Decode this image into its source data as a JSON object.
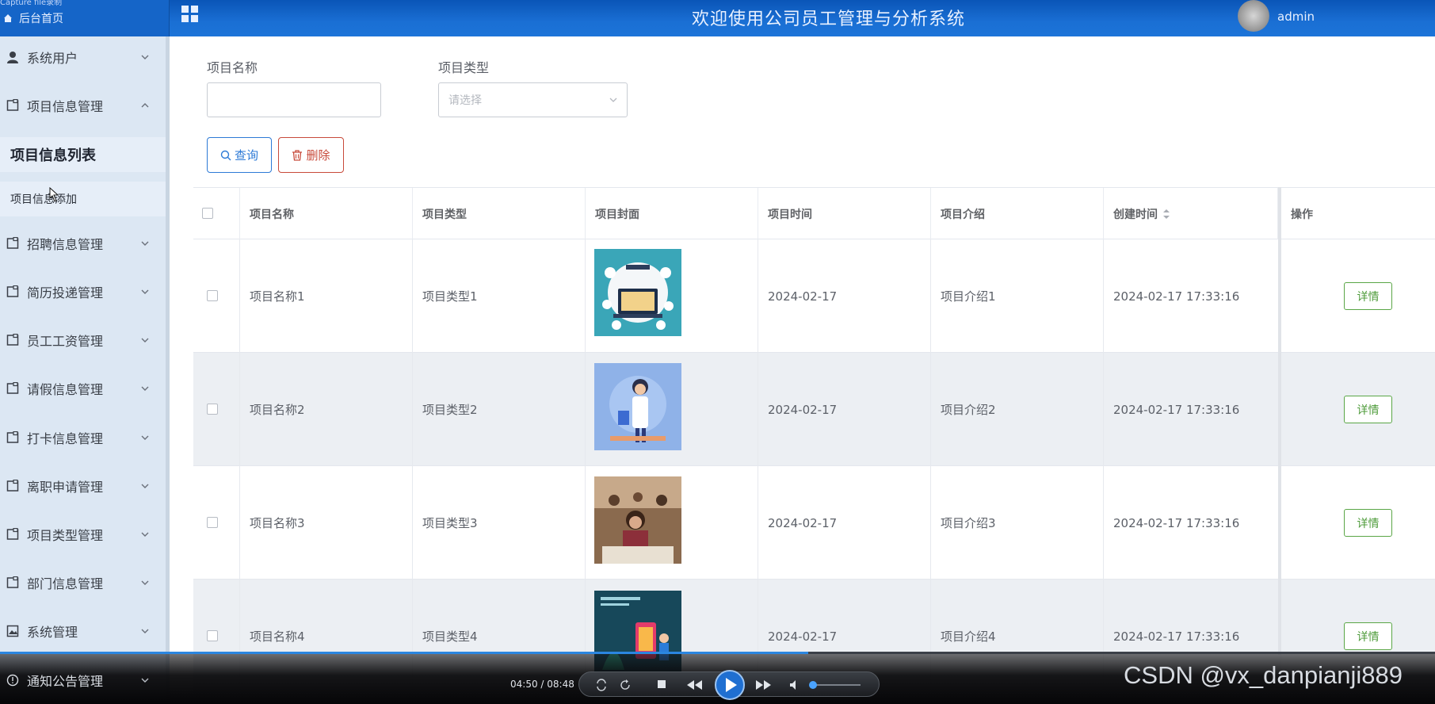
{
  "header": {
    "caption": "Capture file录制",
    "home_label": "后台首页",
    "title": "欢迎使用公司员工管理与分析系统",
    "user": "admin"
  },
  "sidebar": {
    "items": [
      {
        "label": "系统用户",
        "icon": "user-icon",
        "expanded": false
      },
      {
        "label": "项目信息管理",
        "icon": "doc-icon",
        "expanded": true
      },
      {
        "label": "招聘信息管理",
        "icon": "doc-icon",
        "expanded": false
      },
      {
        "label": "简历投递管理",
        "icon": "doc-icon",
        "expanded": false
      },
      {
        "label": "员工工资管理",
        "icon": "doc-icon",
        "expanded": false
      },
      {
        "label": "请假信息管理",
        "icon": "doc-icon",
        "expanded": false
      },
      {
        "label": "打卡信息管理",
        "icon": "doc-icon",
        "expanded": false
      },
      {
        "label": "离职申请管理",
        "icon": "doc-icon",
        "expanded": false
      },
      {
        "label": "项目类型管理",
        "icon": "doc-icon",
        "expanded": false
      },
      {
        "label": "部门信息管理",
        "icon": "doc-icon",
        "expanded": false
      },
      {
        "label": "系统管理",
        "icon": "image-icon",
        "expanded": false
      },
      {
        "label": "通知公告管理",
        "icon": "info-icon",
        "expanded": false
      }
    ],
    "subitems": [
      {
        "label": "项目信息列表",
        "active": true
      },
      {
        "label": "项目信息添加",
        "active": false
      }
    ]
  },
  "filters": {
    "name_label": "项目名称",
    "type_label": "项目类型",
    "type_placeholder": "请选择",
    "query_button": "查询",
    "delete_button": "删除"
  },
  "table": {
    "headers": [
      "项目名称",
      "项目类型",
      "项目封面",
      "项目时间",
      "项目介绍",
      "创建时间",
      "操作"
    ],
    "detail_label": "详情",
    "rows": [
      {
        "name": "项目名称1",
        "type": "项目类型1",
        "date": "2024-02-17",
        "intro": "项目介绍1",
        "created": "2024-02-17 17:33:16"
      },
      {
        "name": "项目名称2",
        "type": "项目类型2",
        "date": "2024-02-17",
        "intro": "项目介绍2",
        "created": "2024-02-17 17:33:16"
      },
      {
        "name": "项目名称3",
        "type": "项目类型3",
        "date": "2024-02-17",
        "intro": "项目介绍3",
        "created": "2024-02-17 17:33:16"
      },
      {
        "name": "项目名称4",
        "type": "项目类型4",
        "date": "2024-02-17",
        "intro": "项目介绍4",
        "created": "2024-02-17 17:33:16"
      }
    ]
  },
  "player": {
    "time": "04:50 / 08:48",
    "progress": 0.563
  },
  "watermark": "CSDN @vx_danpianji889",
  "colors": {
    "header_blue": "#1a6fd4",
    "sidebar_bg": "#dce7f3",
    "primary": "#2d7ad6",
    "danger": "#c84a3a",
    "success": "#5aa646"
  }
}
